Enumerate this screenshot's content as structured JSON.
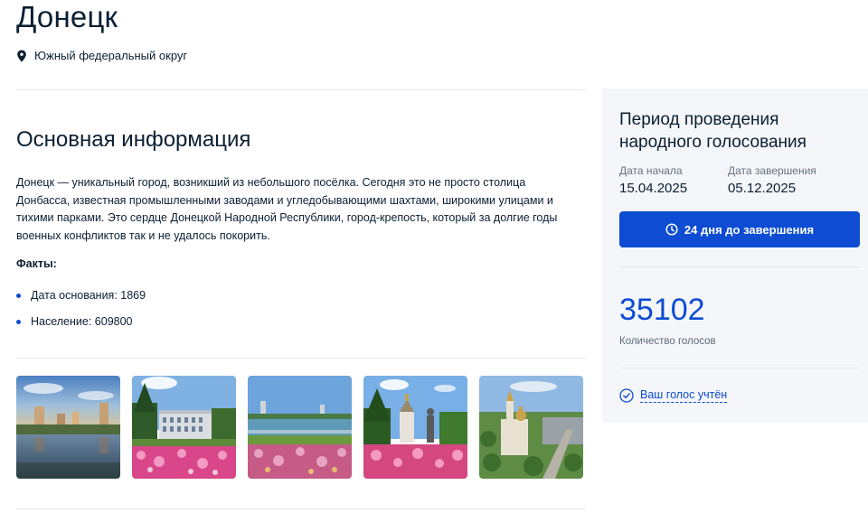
{
  "header": {
    "title": "Донецк",
    "location": "Южный федеральный округ",
    "location_icon": "map-pin-icon"
  },
  "main": {
    "section_title": "Основная информация",
    "description": "Донецк — уникальный город, возникший из небольшого посёлка. Сегодня это не просто столица Донбасса, известная промышленными заводами и угледобывающими шахтами, широкими улицами и тихими парками. Это сердце Донецкой Народной Республики, город-крепость, который за долгие годы военных конфликтов так и не удалось покорить.",
    "facts_title": "Факты:",
    "facts": [
      "Дата основания: 1869",
      "Население: 609800"
    ],
    "photos": [
      "city-lake-skyline",
      "administration-building-flowers",
      "embankment-flowers",
      "chapel-monument-flowers",
      "cathedral-aerial-view"
    ]
  },
  "voting_panel": {
    "title": "Период проведения народного голосования",
    "start_label": "Дата начала",
    "start_date": "15.04.2025",
    "end_label": "Дата завершения",
    "end_date": "05.12.2025",
    "countdown_button": "24 дня до завершения",
    "countdown_icon": "clock-icon",
    "vote_count": "35102",
    "vote_count_label": "Количество голосов",
    "vote_status": "Ваш голос учтён",
    "vote_status_icon": "check-circle-icon"
  },
  "colors": {
    "accent": "#0d4cd3",
    "text": "#0b1f33",
    "panel_bg": "#f4f6f9",
    "muted": "#66727f"
  }
}
